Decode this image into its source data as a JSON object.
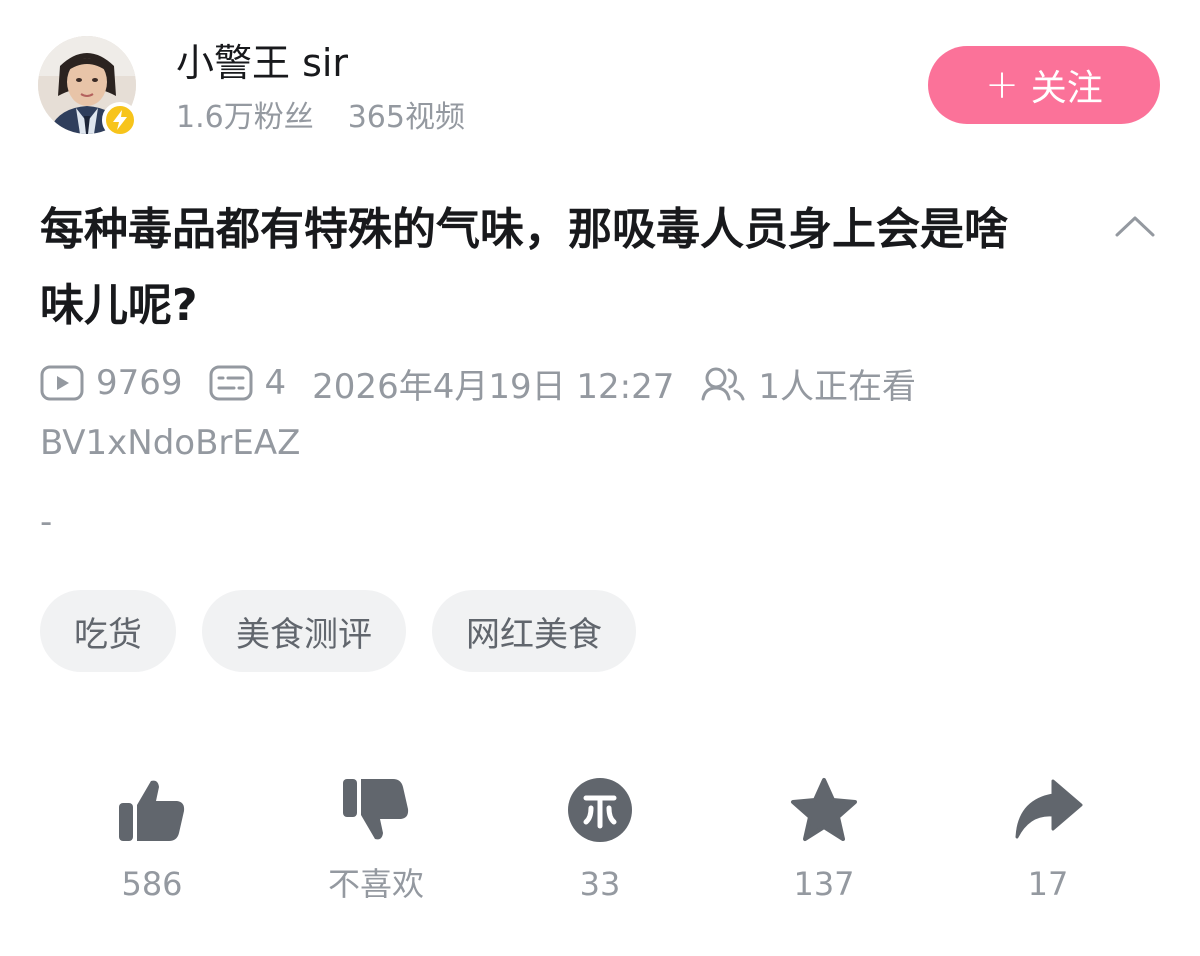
{
  "uploader": {
    "name": "小警王 sir",
    "followers": "1.6万粉丝",
    "videos": "365视频",
    "follow_label": "关注",
    "follow_plus": "+"
  },
  "video": {
    "title": "每种毒品都有特殊的气味，那吸毒人员身上会是啥味儿呢?",
    "views": "9769",
    "danmaku": "4",
    "date": "2026年4月19日 12:27",
    "watching": "1人正在看",
    "bvid": "BV1xNdoBrEAZ",
    "description": "-"
  },
  "tags": [
    "吃货",
    "美食测评",
    "网红美食"
  ],
  "actions": {
    "like": "586",
    "dislike": "不喜欢",
    "coin": "33",
    "favorite": "137",
    "share": "17"
  },
  "colors": {
    "accent_pink": "#fb7299",
    "text_gray": "#9499a0",
    "icon_dark": "#61666d",
    "tag_bg": "#f1f2f3",
    "badge_yellow": "#f7c41b"
  },
  "icons": [
    "play-count-icon",
    "danmaku-icon",
    "watching-icon",
    "chevron-up-icon",
    "like-icon",
    "dislike-icon",
    "coin-icon",
    "favorite-icon",
    "share-icon"
  ]
}
